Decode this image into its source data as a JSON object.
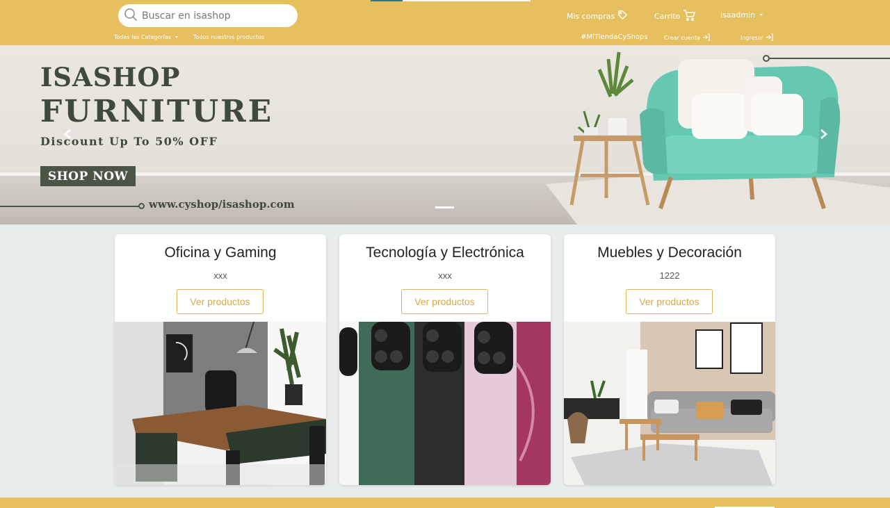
{
  "header": {
    "search_placeholder": "Buscar en isashop",
    "mis_compras": "Mis compras",
    "carrito": "Carrito",
    "user": "isaadmin",
    "categories": "Todas las Categorías",
    "all_products": "Todos nuestros productos",
    "hashtag": "#MiTiendaCyShops",
    "create_account": "Crear cuenta",
    "login": "Ingresar",
    "brand_color": "#e6bf5e"
  },
  "banner": {
    "brand_line1": "ISASHOP",
    "brand_line2": "FURNITURE",
    "discount": "Discount Up To 50% OFF",
    "cta": "SHOP NOW",
    "url": "www.cyshop/isashop.com"
  },
  "cards": [
    {
      "title": "Oficina y Gaming",
      "desc": "xxx",
      "button": "Ver productos"
    },
    {
      "title": "Tecnología y Electrónica",
      "desc": "xxx",
      "button": "Ver productos"
    },
    {
      "title": "Muebles y Decoración",
      "desc": "1222",
      "button": "Ver productos"
    }
  ]
}
